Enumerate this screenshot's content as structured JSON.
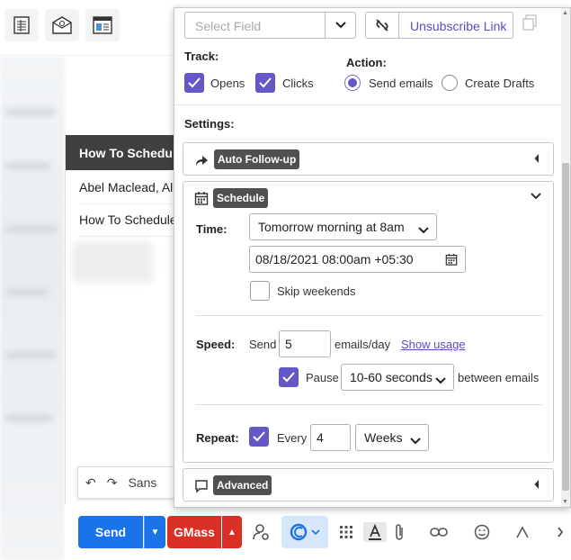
{
  "compose": {
    "header_title": "How To Schedule",
    "to_field": "Abel Maclead, All",
    "subject_field": "How To Schedule",
    "font_name": "Sans",
    "send_label": "Send",
    "gmass_label": "GMass"
  },
  "panel": {
    "select_field_placeholder": "Select Field",
    "unsubscribe_label": "Unsubscribe Link",
    "track_label": "Track:",
    "opens_label": "Opens",
    "clicks_label": "Clicks",
    "action_label": "Action:",
    "send_emails_label": "Send emails",
    "create_drafts_label": "Create Drafts",
    "settings_label": "Settings:",
    "auto_followup_title": "Auto Follow-up",
    "schedule_title": "Schedule",
    "time_label": "Time:",
    "time_option": "Tomorrow morning at 8am",
    "datetime_value": "08/18/2021 08:00am +05:30",
    "skip_weekends_label": "Skip weekends",
    "speed_label": "Speed:",
    "send_word": "Send",
    "emails_per_day_value": "5",
    "emails_per_day_label": "emails/day",
    "show_usage_link": "Show usage",
    "pause_label": "Pause",
    "pause_option": "10-60 seconds",
    "between_emails_label": "between emails",
    "repeat_label": "Repeat:",
    "every_label": "Every",
    "repeat_value": "4",
    "repeat_unit": "Weeks",
    "advanced_title": "Advanced"
  },
  "colors": {
    "accent": "#6457c6",
    "send_blue": "#1a73e8",
    "gmass_red": "#d93025",
    "section_title_bg": "#505050"
  }
}
